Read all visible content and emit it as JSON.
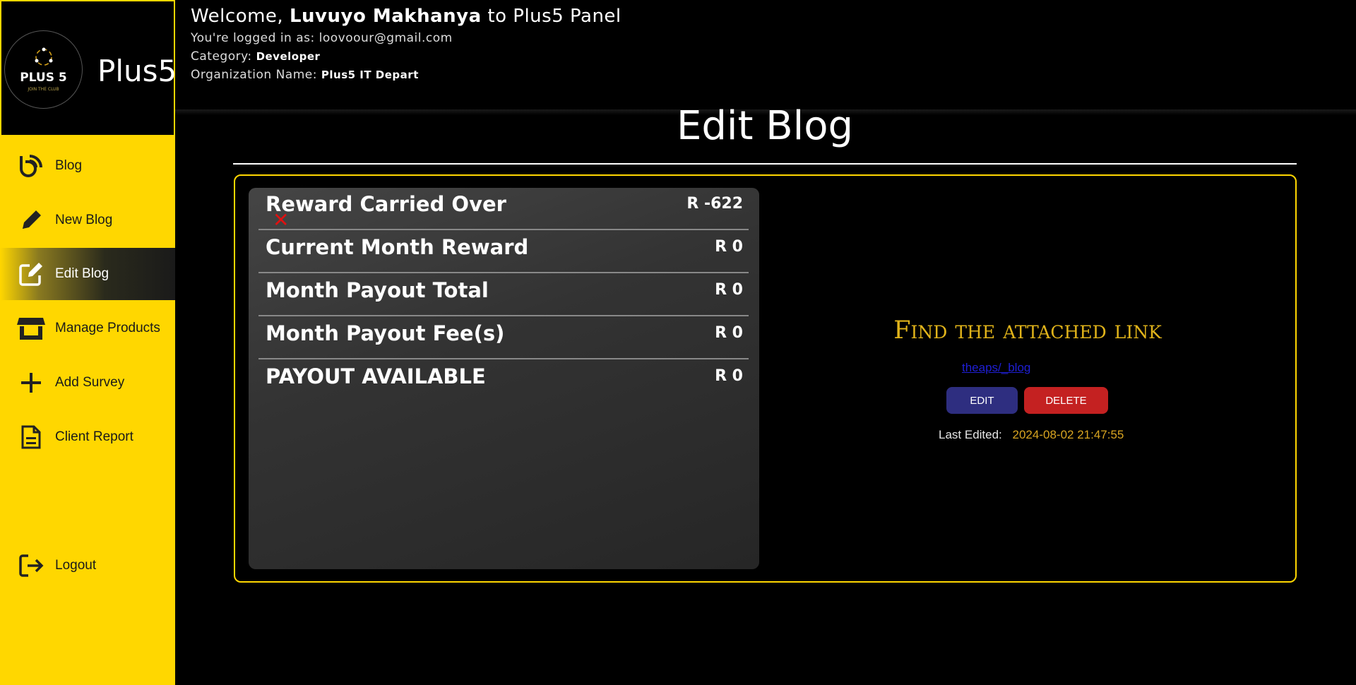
{
  "brand": {
    "name": "Plus5",
    "logo_text": "PLUS 5",
    "logo_tagline": "JOIN THE CLUB"
  },
  "colors": {
    "accent": "#ffd700",
    "edit_button": "#2e2e80",
    "delete_button": "#c42121",
    "heading_gold": "#e0b31a"
  },
  "sidebar": {
    "items": [
      {
        "label": "Blog",
        "icon": "blog-feed-icon"
      },
      {
        "label": "New Blog",
        "icon": "pencil-icon"
      },
      {
        "label": "Edit Blog",
        "icon": "edit-square-icon",
        "active": true
      },
      {
        "label": "Manage Products",
        "icon": "store-icon"
      },
      {
        "label": "Add Survey",
        "icon": "plus-icon"
      },
      {
        "label": "Client Report",
        "icon": "file-text-icon"
      }
    ],
    "logout_label": "Logout"
  },
  "header": {
    "welcome_prefix": "Welcome,",
    "user_name": "Luvuyo Makhanya",
    "welcome_suffix": "to Plus5 Panel",
    "logged_in_label": "You're logged in as:",
    "email": "loovoour@gmail.com",
    "category_label": "Category:",
    "category": "Developer",
    "org_label": "Organization Name:",
    "org": "Plus5 IT Depart"
  },
  "page": {
    "title": "Edit Blog"
  },
  "rewards": [
    {
      "label": "Reward Carried Over",
      "value": "R -622"
    },
    {
      "label": "Current Month Reward",
      "value": "R 0"
    },
    {
      "label": "Month Payout Total",
      "value": "R 0"
    },
    {
      "label": "Month Payout Fee(s)",
      "value": "R 0"
    },
    {
      "label": "PAYOUT AVAILABLE",
      "value": "R 0"
    }
  ],
  "close_glyph": "✕",
  "blog": {
    "heading": "Find the attached link",
    "link_text": "theaps/_blog",
    "edit_label": "EDIT",
    "delete_label": "DELETE",
    "last_edited_label": "Last Edited:",
    "last_edited_value": "2024-08-02 21:47:55"
  }
}
